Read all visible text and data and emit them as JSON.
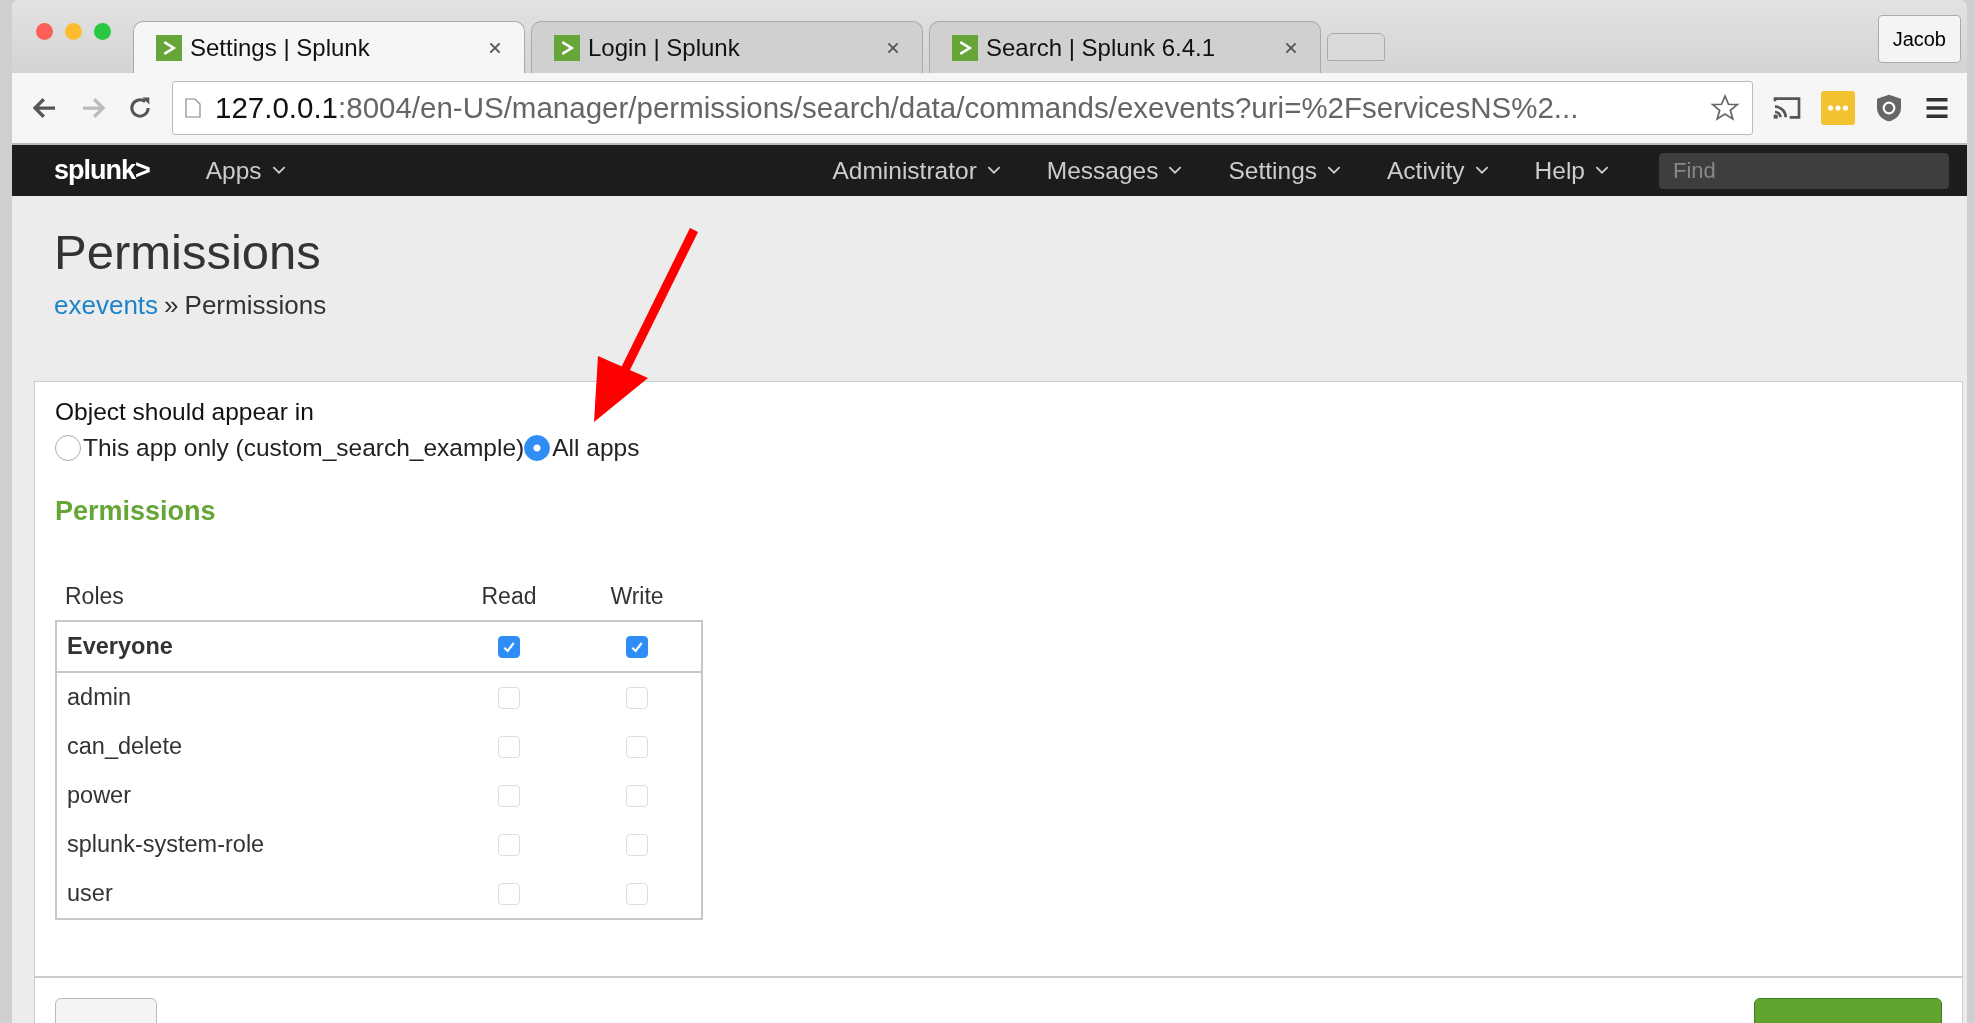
{
  "browser": {
    "tabs": [
      {
        "title": "Settings | Splunk",
        "selected": true
      },
      {
        "title": "Login | Splunk",
        "selected": false
      },
      {
        "title": "Search | Splunk 6.4.1",
        "selected": false
      }
    ],
    "profile": "Jacob",
    "address": {
      "host": "127.0.0.1",
      "rest": ":8004/en-US/manager/permissions/search/data/commands/exevents?uri=%2FservicesNS%2..."
    }
  },
  "navbar": {
    "logo": "splunk>",
    "apps": "Apps",
    "menus": [
      "Administrator",
      "Messages",
      "Settings",
      "Activity",
      "Help"
    ],
    "search": {
      "placeholder": "Find"
    }
  },
  "page": {
    "title": "Permissions",
    "breadcrumb": {
      "link": "exevents",
      "separator": "»",
      "current": "Permissions"
    }
  },
  "sharing": {
    "label": "Object should appear in",
    "options": [
      {
        "label": "This app only (custom_search_example)",
        "selected": false
      },
      {
        "label": "All apps",
        "selected": true
      }
    ]
  },
  "permissions": {
    "heading": "Permissions",
    "columns": [
      "Roles",
      "Read",
      "Write"
    ],
    "rows": [
      {
        "role": "Everyone",
        "bold": true,
        "read": true,
        "write": true
      },
      {
        "role": "admin",
        "bold": false,
        "read": false,
        "write": false
      },
      {
        "role": "can_delete",
        "bold": false,
        "read": false,
        "write": false
      },
      {
        "role": "power",
        "bold": false,
        "read": false,
        "write": false
      },
      {
        "role": "splunk-system-role",
        "bold": false,
        "read": false,
        "write": false
      },
      {
        "role": "user",
        "bold": false,
        "read": false,
        "write": false
      }
    ]
  },
  "footer": {
    "buttons": [
      {
        "kind": "secondary"
      },
      {
        "kind": "primary"
      }
    ]
  }
}
